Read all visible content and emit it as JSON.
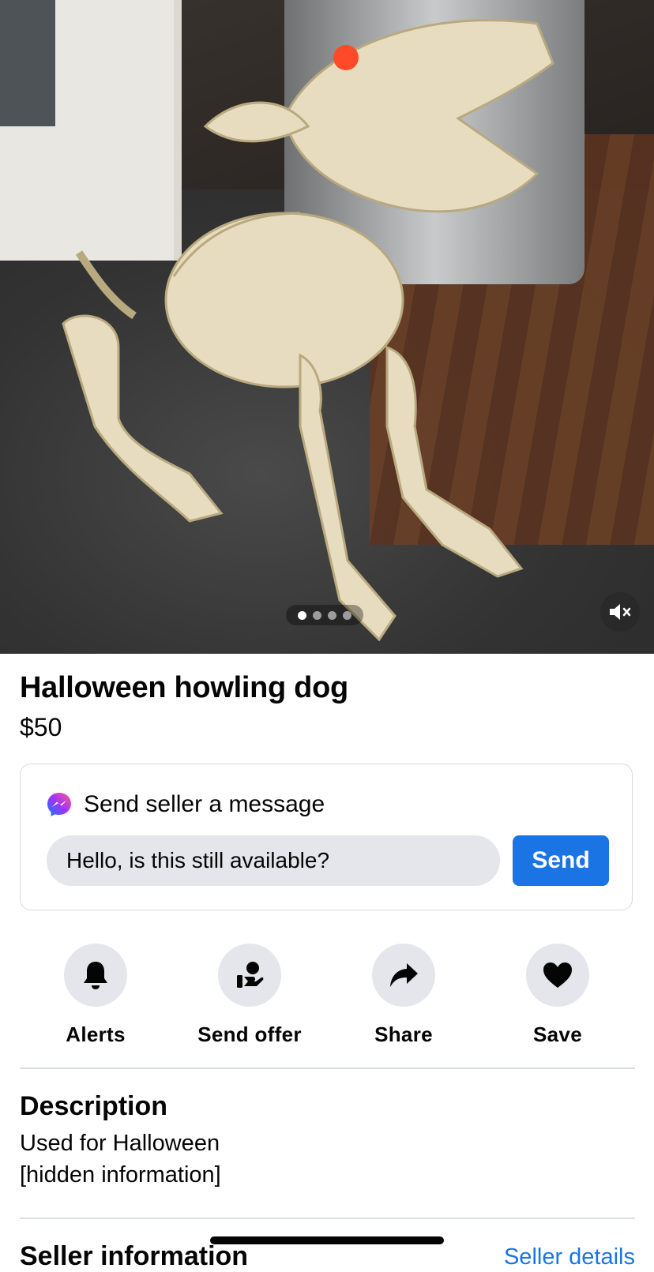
{
  "listing": {
    "title": "Halloween howling dog",
    "price": "$50",
    "photo_count": 4,
    "active_photo": 1
  },
  "media": {
    "mute_icon": "speaker-muted-icon"
  },
  "message": {
    "heading": "Send seller a message",
    "input_value": "Hello, is this still available?",
    "send_label": "Send",
    "icon": "messenger-icon"
  },
  "actions": [
    {
      "label": "Alerts",
      "icon": "bell-icon"
    },
    {
      "label": "Send offer",
      "icon": "offer-hand-icon"
    },
    {
      "label": "Share",
      "icon": "share-arrow-icon"
    },
    {
      "label": "Save",
      "icon": "heart-icon"
    }
  ],
  "description": {
    "heading": "Description",
    "line1": "Used for Halloween",
    "line2": "[hidden information]"
  },
  "seller": {
    "heading": "Seller information",
    "details_link": "Seller details"
  },
  "colors": {
    "accent": "#1b74e4",
    "chip_bg": "#e4e6eb",
    "text": "#050505"
  }
}
